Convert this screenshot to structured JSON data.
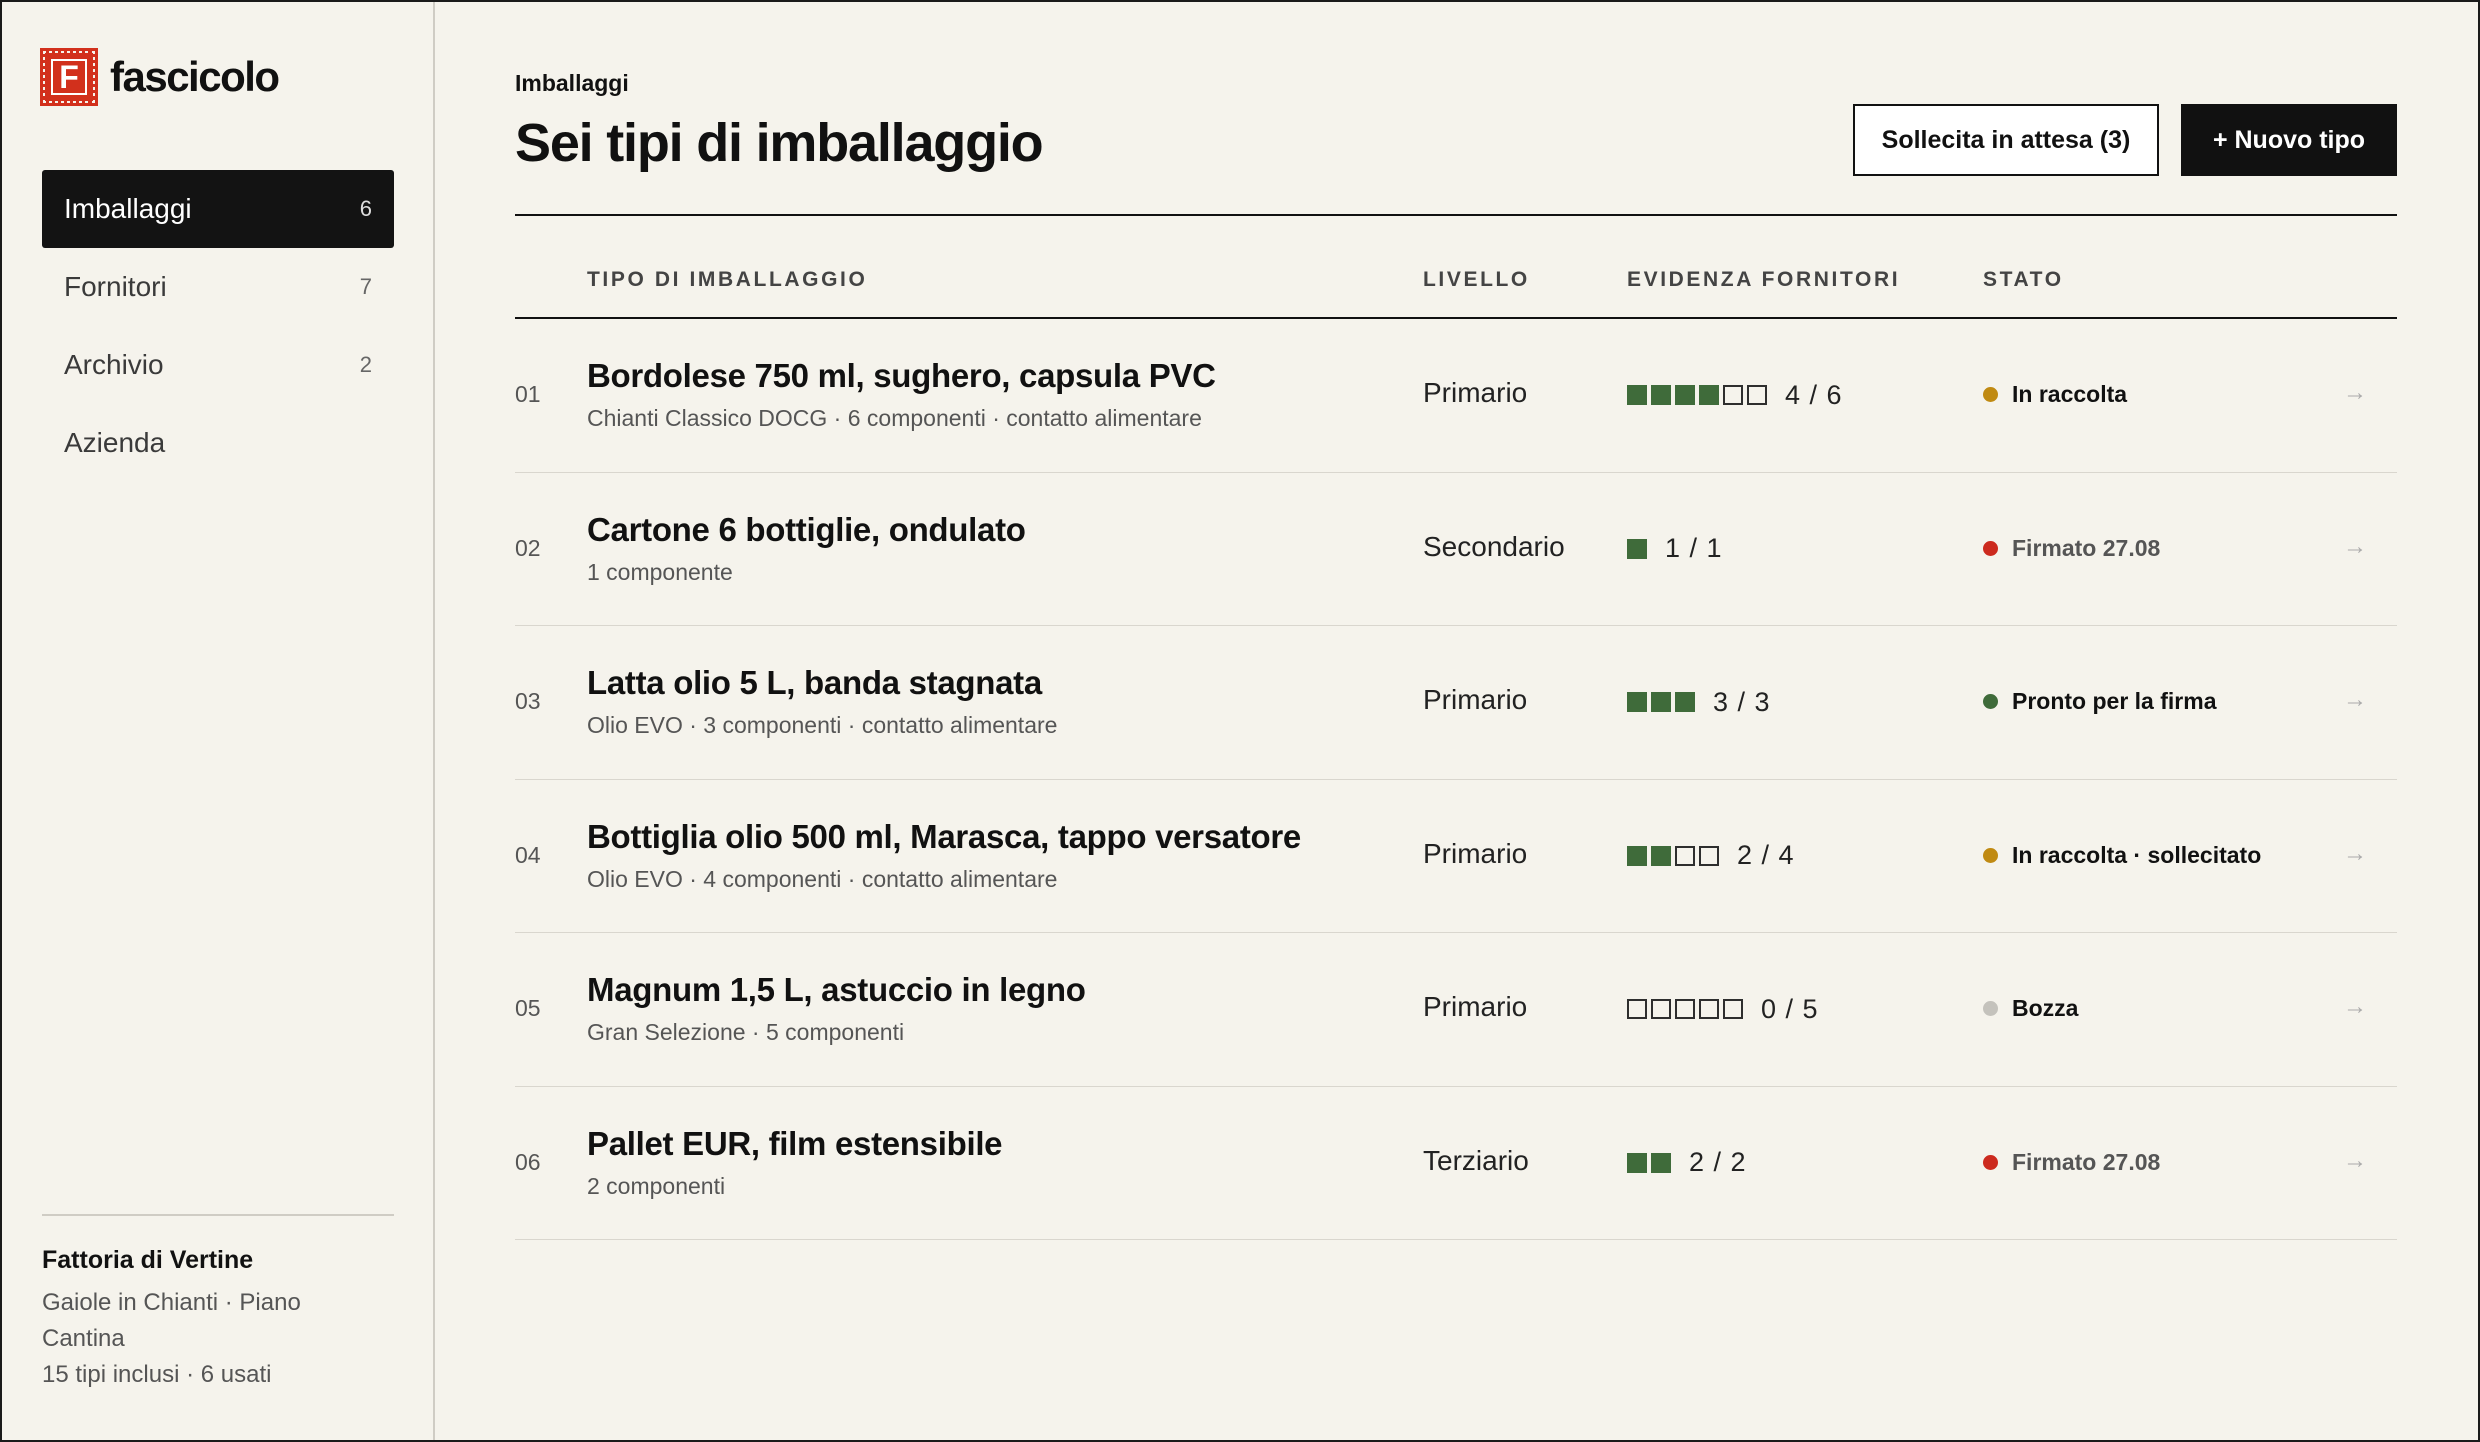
{
  "app": {
    "logo_letter": "F",
    "name": "fascicolo",
    "brand_color": "#d2301c"
  },
  "sidebar": {
    "items": [
      {
        "label": "Imballaggi",
        "count": "6",
        "active": true
      },
      {
        "label": "Fornitori",
        "count": "7",
        "active": false
      },
      {
        "label": "Archivio",
        "count": "2",
        "active": false
      },
      {
        "label": "Azienda",
        "count": "",
        "active": false
      }
    ],
    "org": {
      "name": "Fattoria di Vertine",
      "location": "Gaiole in Chianti · Piano",
      "location2": "Cantina",
      "usage": "15 tipi inclusi · 6 usati"
    }
  },
  "header": {
    "breadcrumb": "Imballaggi",
    "title": "Sei tipi di imballaggio",
    "remind_button": "Sollecita in attesa (3)",
    "new_button": "+ Nuovo tipo"
  },
  "table": {
    "columns": {
      "type": "TIPO DI IMBALLAGGIO",
      "level": "LIVELLO",
      "evidence": "EVIDENZA FORNITORI",
      "status": "STATO"
    },
    "rows": [
      {
        "num": "01",
        "name": "Bordolese 750 ml, sughero, capsula PVC",
        "sub": "Chianti Classico DOCG · 6 componenti · contatto alimentare",
        "level": "Primario",
        "filled": 4,
        "total": 6,
        "evidence": "4 / 6",
        "status": "In raccolta",
        "status_color": "#c08a12",
        "status_muted": false,
        "arrow": "→"
      },
      {
        "num": "02",
        "name": "Cartone 6 bottiglie, ondulato",
        "sub": "1 componente",
        "level": "Secondario",
        "filled": 1,
        "total": 1,
        "evidence": "1 / 1",
        "status": "Firmato 27.08",
        "status_color": "#cc2a1e",
        "status_muted": true,
        "arrow": "→"
      },
      {
        "num": "03",
        "name": "Latta olio 5 L, banda stagnata",
        "sub": "Olio EVO · 3 componenti · contatto alimentare",
        "level": "Primario",
        "filled": 3,
        "total": 3,
        "evidence": "3 / 3",
        "status": "Pronto per la firma",
        "status_color": "#3f6b3a",
        "status_muted": false,
        "arrow": "→"
      },
      {
        "num": "04",
        "name": "Bottiglia olio 500 ml, Marasca, tappo versatore",
        "sub": "Olio EVO · 4 componenti · contatto alimentare",
        "level": "Primario",
        "filled": 2,
        "total": 4,
        "evidence": "2 / 4",
        "status": "In raccolta · sollecitato",
        "status_color": "#c08a12",
        "status_muted": false,
        "arrow": "→"
      },
      {
        "num": "05",
        "name": "Magnum 1,5 L, astuccio in legno",
        "sub": "Gran Selezione · 5 componenti",
        "level": "Primario",
        "filled": 0,
        "total": 5,
        "evidence": "0 / 5",
        "status": "Bozza",
        "status_color": "#c4c2bc",
        "status_muted": false,
        "arrow": "→"
      },
      {
        "num": "06",
        "name": "Pallet EUR, film estensibile",
        "sub": "2 componenti",
        "level": "Terziario",
        "filled": 2,
        "total": 2,
        "evidence": "2 / 2",
        "status": "Firmato 27.08",
        "status_color": "#cc2a1e",
        "status_muted": true,
        "arrow": "→"
      }
    ]
  }
}
